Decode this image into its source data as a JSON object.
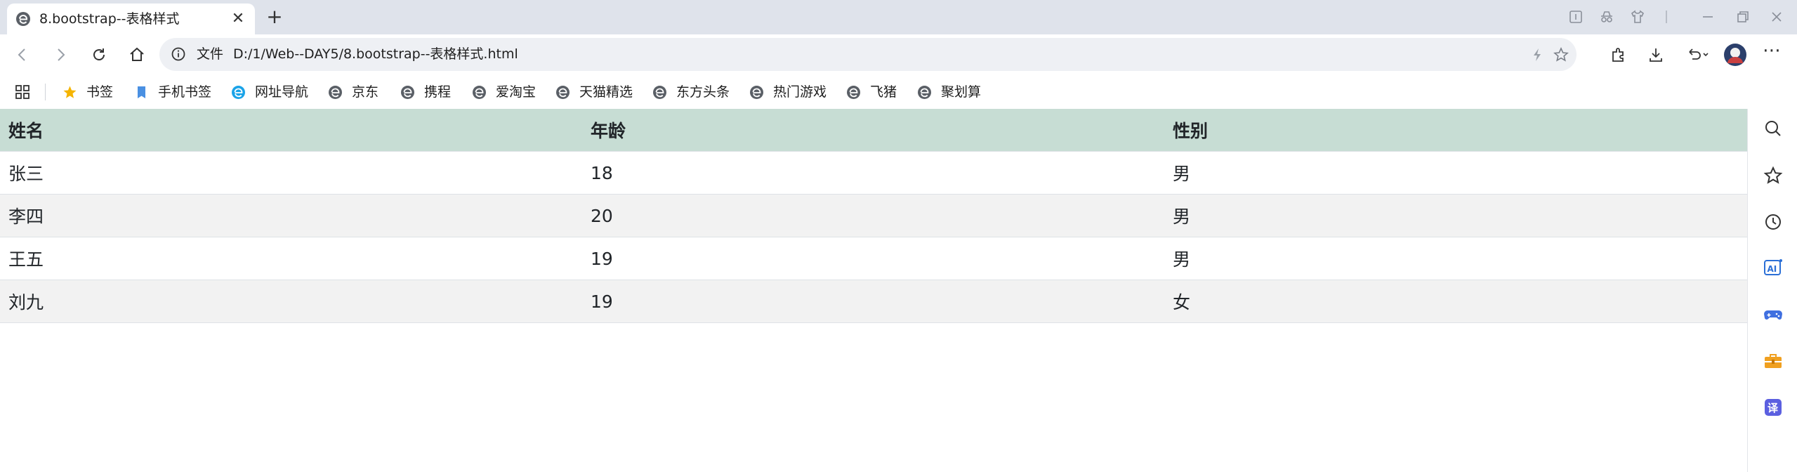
{
  "browser": {
    "tab": {
      "title": "8.bootstrap--表格样式",
      "favicon": "edge-e-icon"
    },
    "address": {
      "scheme_label": "文件",
      "url": "D:/1/Web--DAY5/8.bootstrap--表格样式.html"
    },
    "bookmarks": [
      {
        "label": "书签",
        "icon": "star-icon"
      },
      {
        "label": "手机书签",
        "icon": "phone-bookmark-icon"
      },
      {
        "label": "网址导航",
        "icon": "nav-e-icon"
      },
      {
        "label": "京东",
        "icon": "e-icon"
      },
      {
        "label": "携程",
        "icon": "e-icon"
      },
      {
        "label": "爱淘宝",
        "icon": "e-icon"
      },
      {
        "label": "天猫精选",
        "icon": "e-icon"
      },
      {
        "label": "东方头条",
        "icon": "e-icon"
      },
      {
        "label": "热门游戏",
        "icon": "e-icon"
      },
      {
        "label": "飞猪",
        "icon": "e-icon"
      },
      {
        "label": "聚划算",
        "icon": "e-icon"
      }
    ]
  },
  "table": {
    "headers": [
      "姓名",
      "年龄",
      "性别"
    ],
    "rows": [
      [
        "张三",
        "18",
        "男"
      ],
      [
        "李四",
        "20",
        "男"
      ],
      [
        "王五",
        "19",
        "男"
      ],
      [
        "刘九",
        "19",
        "女"
      ]
    ]
  },
  "colors": {
    "header_bg": "#c7ddd4",
    "stripe_bg": "#f2f2f2",
    "titlebar_bg": "#dfe3eb",
    "omnibox_bg": "#eef0f4"
  },
  "sidebar_icons": [
    "search-icon",
    "favorites-star-icon",
    "history-clock-icon",
    "ai-icon",
    "game-controller-icon",
    "toolbox-icon",
    "translate-icon"
  ]
}
